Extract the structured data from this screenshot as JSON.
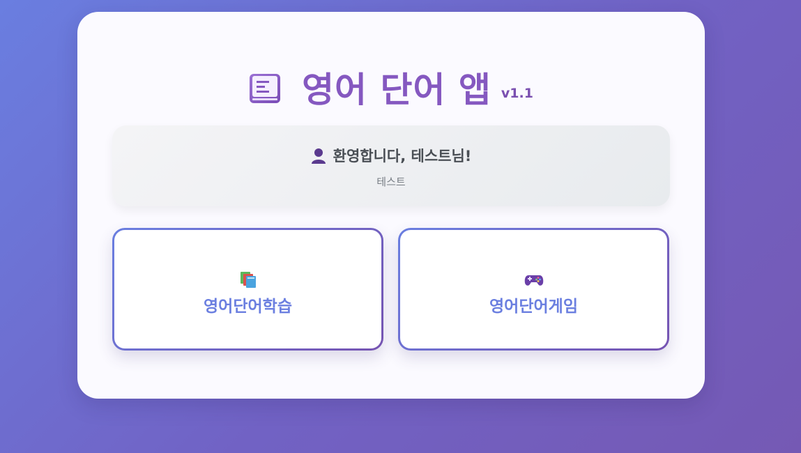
{
  "header": {
    "icon": "book-icon",
    "title": "영어 단어 앱",
    "version": "v1.1"
  },
  "welcome": {
    "icon": "user-icon",
    "message": "환영합니다, 테스트님!",
    "username": "테스트"
  },
  "menu": {
    "items": [
      {
        "icon": "books-icon",
        "label": "영어단어학습"
      },
      {
        "icon": "game-controller-icon",
        "label": "영어단어게임"
      }
    ]
  },
  "colors": {
    "background_start": "#6a7ee0",
    "background_end": "#7559b4",
    "title": "#8558c0",
    "menu_label": "#6b7fe0"
  }
}
